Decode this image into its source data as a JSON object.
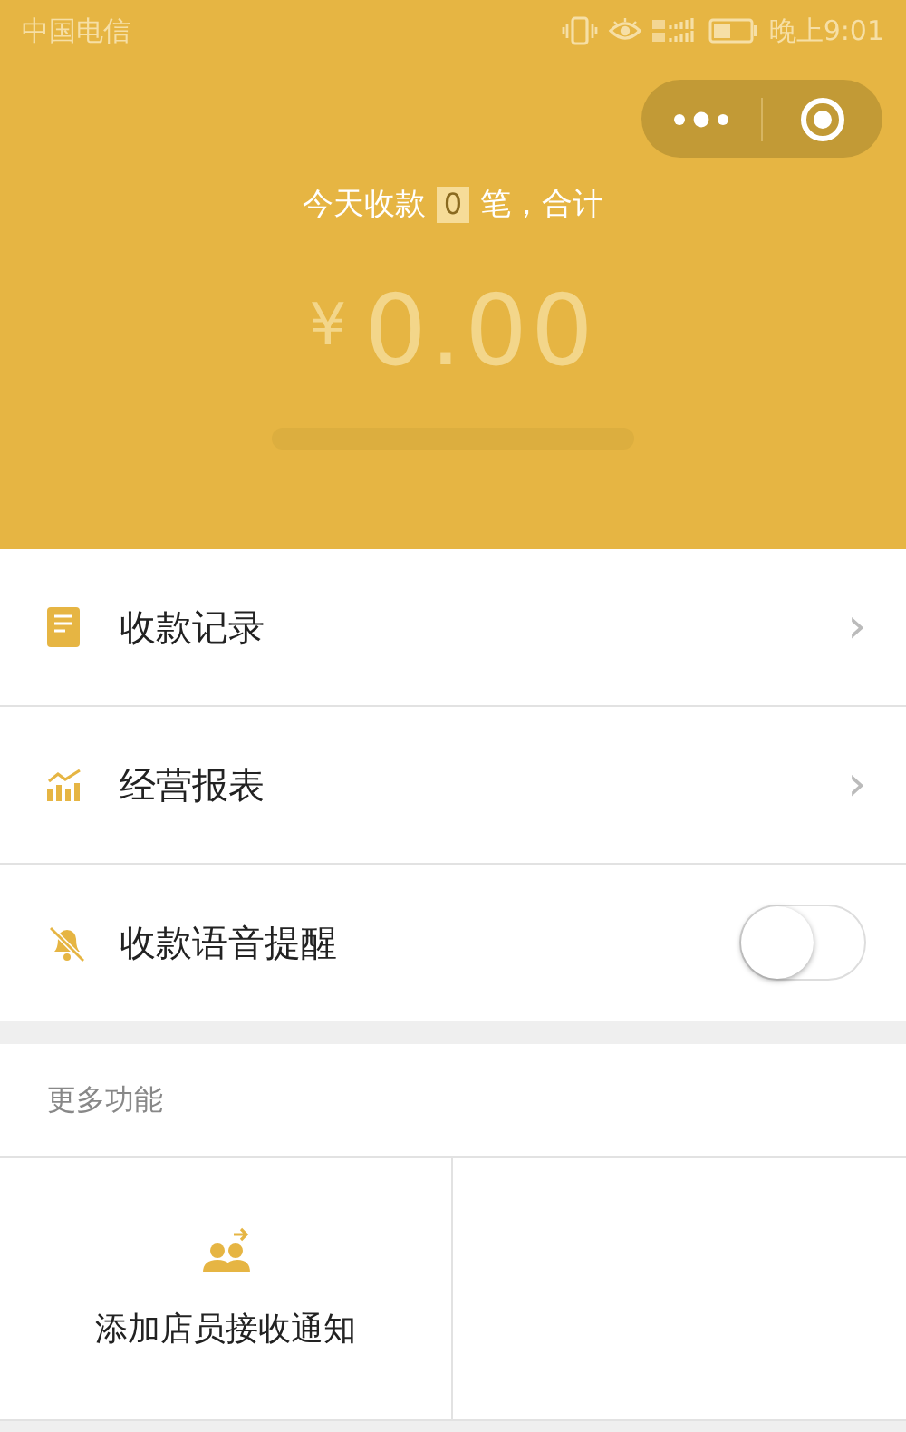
{
  "status_bar": {
    "carrier": "中国电信",
    "time": "晚上9:01"
  },
  "header": {
    "summary": {
      "prefix": "今天收款",
      "count": "0",
      "suffix": "笔，合计"
    },
    "currency": "¥",
    "amount": "0.00"
  },
  "menu": [
    {
      "kind": "link",
      "label": "收款记录",
      "chevron": "›"
    },
    {
      "kind": "link",
      "label": "经营报表",
      "chevron": "›"
    },
    {
      "kind": "toggle",
      "label": "收款语音提醒",
      "on": false
    }
  ],
  "more": {
    "title": "更多功能",
    "items": [
      {
        "label": "添加店员接收通知"
      }
    ]
  }
}
